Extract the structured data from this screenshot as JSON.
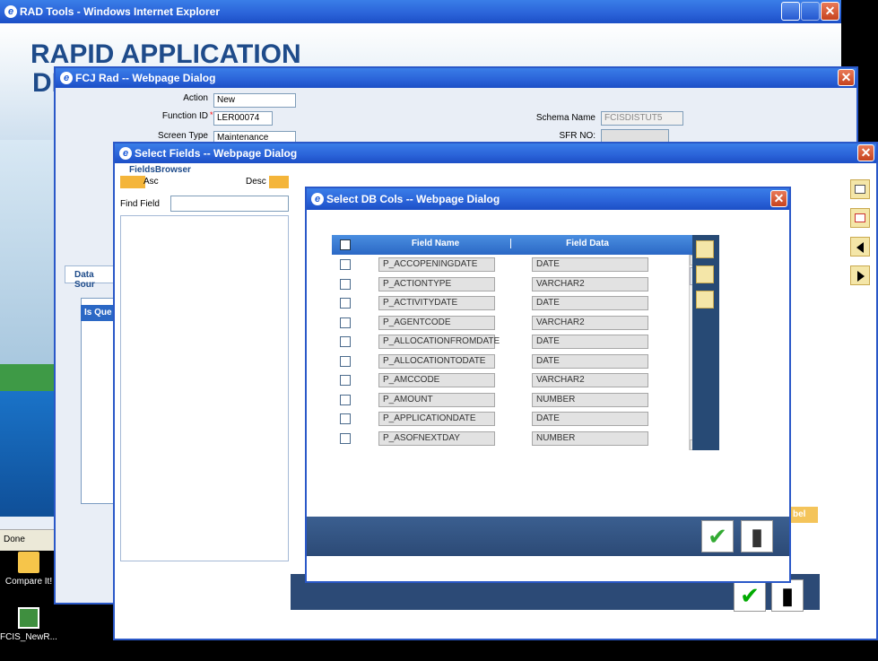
{
  "ie_window": {
    "title": "RAD Tools - Windows Internet Explorer",
    "banner": "RAPID APPLICATION",
    "banner_line2": "DI",
    "status": "Done"
  },
  "desktop": {
    "icons": [
      {
        "label": "Compare It!"
      },
      {
        "label": "FCIS_NewR..."
      }
    ]
  },
  "fcj_dialog": {
    "title": "FCJ Rad -- Webpage Dialog",
    "action_label": "Action",
    "action_value": "New",
    "function_id_label": "Function ID",
    "function_id_value": "LER00074",
    "screen_type_label": "Screen Type",
    "screen_type_value": "Maintenance",
    "schema_label": "Schema Name",
    "schema_value": "FCISDISTUT5",
    "sfr_label": "SFR NO:",
    "tab_label": "Data Sour",
    "grid_header": "Is Que"
  },
  "select_fields": {
    "title": "Select Fields -- Webpage Dialog",
    "browser_label": "FieldsBrowser",
    "asc_label": "Asc",
    "desc_label": "Desc",
    "find_label": "Find Field",
    "partial_label": "bel"
  },
  "select_db_cols": {
    "title": "Select DB Cols -- Webpage Dialog",
    "col_field_name": "Field Name",
    "col_field_data": "Field Data",
    "rows": [
      {
        "name": "P_ACCOPENINGDATE",
        "data": "DATE"
      },
      {
        "name": "P_ACTIONTYPE",
        "data": "VARCHAR2"
      },
      {
        "name": "P_ACTIVITYDATE",
        "data": "DATE"
      },
      {
        "name": "P_AGENTCODE",
        "data": "VARCHAR2"
      },
      {
        "name": "P_ALLOCATIONFROMDATE",
        "data": "DATE"
      },
      {
        "name": "P_ALLOCATIONTODATE",
        "data": "DATE"
      },
      {
        "name": "P_AMCCODE",
        "data": "VARCHAR2"
      },
      {
        "name": "P_AMOUNT",
        "data": "NUMBER"
      },
      {
        "name": "P_APPLICATIONDATE",
        "data": "DATE"
      },
      {
        "name": "P_ASOFNEXTDAY",
        "data": "NUMBER"
      }
    ]
  },
  "colors": {
    "titlebar": "#2a62d8",
    "grid_dark": "#2c4d77",
    "button_yellow": "#f4e6a8"
  }
}
